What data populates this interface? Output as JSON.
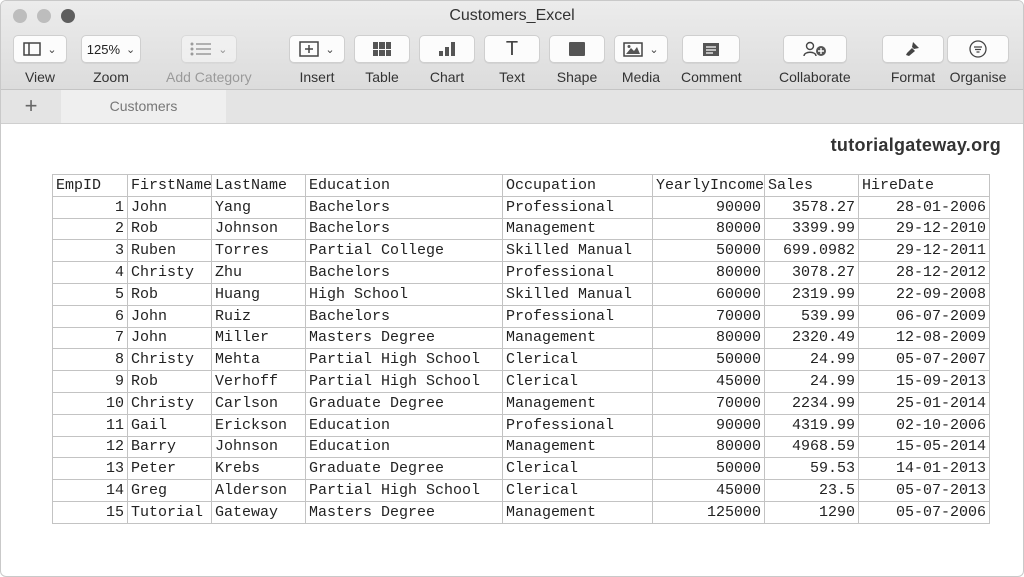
{
  "window": {
    "title": "Customers_Excel"
  },
  "toolbar": {
    "view_label": "View",
    "zoom_value": "125%",
    "zoom_label": "Zoom",
    "add_category_label": "Add Category",
    "insert_label": "Insert",
    "table_label": "Table",
    "chart_label": "Chart",
    "text_glyph": "T",
    "text_label": "Text",
    "shape_label": "Shape",
    "media_label": "Media",
    "comment_label": "Comment",
    "collaborate_label": "Collaborate",
    "format_label": "Format",
    "organise_label": "Organise"
  },
  "tabs": {
    "add_glyph": "+",
    "sheet_name": "Customers"
  },
  "brand": "tutorialgateway.org",
  "table": {
    "headers": [
      "EmpID",
      "FirstName",
      "LastName",
      "Education",
      "Occupation",
      "YearlyIncome",
      "Sales",
      "HireDate"
    ],
    "rows": [
      [
        "1",
        "John",
        "Yang",
        "Bachelors",
        "Professional",
        "90000",
        "3578.27",
        "28-01-2006"
      ],
      [
        "2",
        "Rob",
        "Johnson",
        "Bachelors",
        "Management",
        "80000",
        "3399.99",
        "29-12-2010"
      ],
      [
        "3",
        "Ruben",
        "Torres",
        "Partial College",
        "Skilled Manual",
        "50000",
        "699.0982",
        "29-12-2011"
      ],
      [
        "4",
        "Christy",
        "Zhu",
        "Bachelors",
        "Professional",
        "80000",
        "3078.27",
        "28-12-2012"
      ],
      [
        "5",
        "Rob",
        "Huang",
        "High School",
        "Skilled Manual",
        "60000",
        "2319.99",
        "22-09-2008"
      ],
      [
        "6",
        "John",
        "Ruiz",
        "Bachelors",
        "Professional",
        "70000",
        "539.99",
        "06-07-2009"
      ],
      [
        "7",
        "John",
        "Miller",
        "Masters Degree",
        "Management",
        "80000",
        "2320.49",
        "12-08-2009"
      ],
      [
        "8",
        "Christy",
        "Mehta",
        "Partial High School",
        "Clerical",
        "50000",
        "24.99",
        "05-07-2007"
      ],
      [
        "9",
        "Rob",
        "Verhoff",
        "Partial High School",
        "Clerical",
        "45000",
        "24.99",
        "15-09-2013"
      ],
      [
        "10",
        "Christy",
        "Carlson",
        "Graduate Degree",
        "Management",
        "70000",
        "2234.99",
        "25-01-2014"
      ],
      [
        "11",
        "Gail",
        "Erickson",
        "Education",
        "Professional",
        "90000",
        "4319.99",
        "02-10-2006"
      ],
      [
        "12",
        "Barry",
        "Johnson",
        "Education",
        "Management",
        "80000",
        "4968.59",
        "15-05-2014"
      ],
      [
        "13",
        "Peter",
        "Krebs",
        "Graduate Degree",
        "Clerical",
        "50000",
        "59.53",
        "14-01-2013"
      ],
      [
        "14",
        "Greg",
        "Alderson",
        "Partial High School",
        "Clerical",
        "45000",
        "23.5",
        "05-07-2013"
      ],
      [
        "15",
        "Tutorial",
        "Gateway",
        "Masters Degree",
        "Management",
        "125000",
        "1290",
        "05-07-2006"
      ]
    ]
  }
}
